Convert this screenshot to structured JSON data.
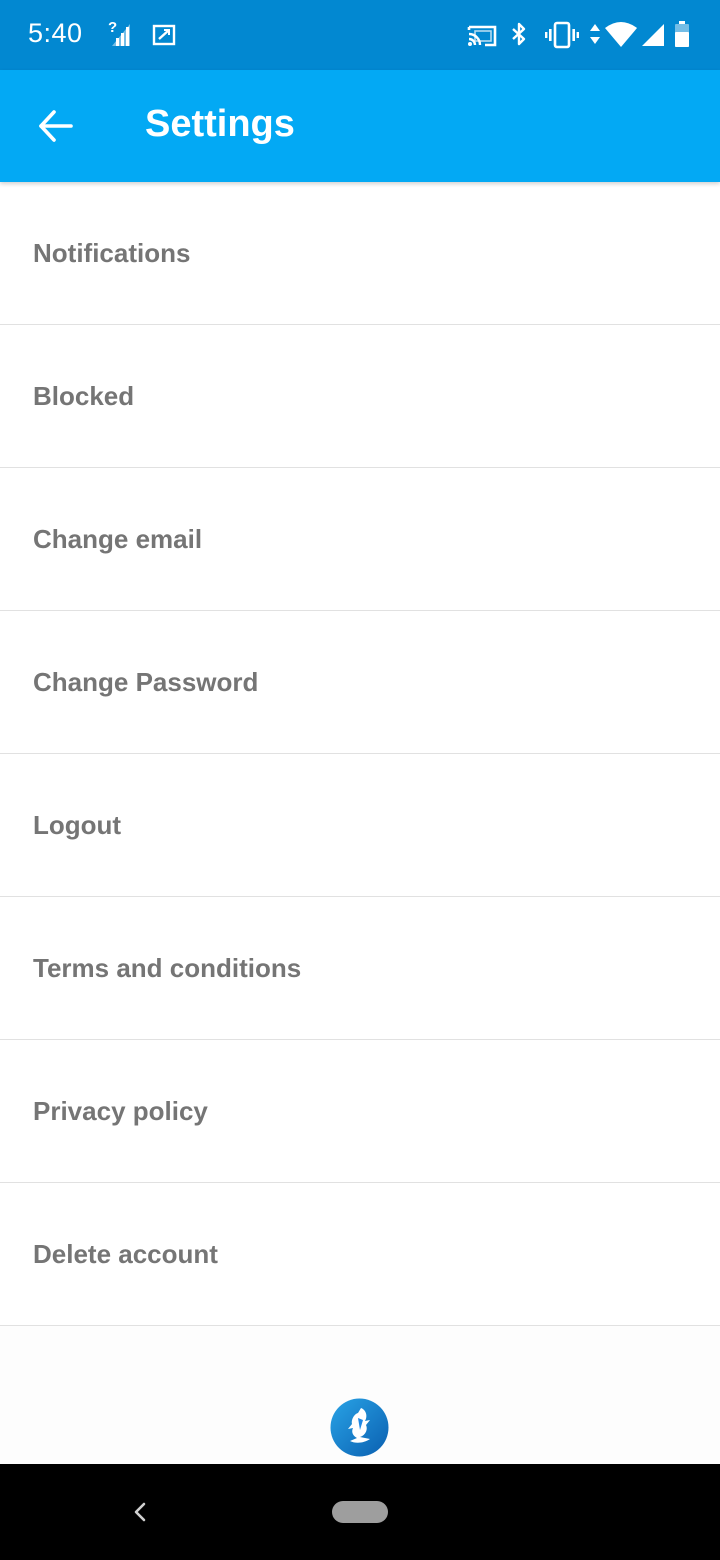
{
  "status_bar": {
    "time": "5:40",
    "icons": [
      "signal-unknown-icon",
      "screenshot-icon",
      "cast-icon",
      "bluetooth-icon",
      "vibrate-icon",
      "data-arrows-icon",
      "wifi-icon",
      "cell-signal-icon",
      "battery-icon"
    ]
  },
  "app_bar": {
    "title": "Settings",
    "back_icon": "arrow-back-icon",
    "color": "#03a9f4"
  },
  "settings": {
    "items": [
      {
        "label": "Notifications"
      },
      {
        "label": "Blocked"
      },
      {
        "label": "Change email"
      },
      {
        "label": "Change Password"
      },
      {
        "label": "Logout"
      },
      {
        "label": "Terms and conditions"
      },
      {
        "label": "Privacy policy"
      },
      {
        "label": "Delete account"
      }
    ]
  },
  "footer": {
    "logo_icon": "app-logo-icon"
  },
  "nav_bar": {
    "back_icon": "nav-back-icon",
    "home_icon": "nav-home-pill-icon"
  },
  "colors": {
    "status_bar": "#0288d1",
    "app_bar": "#03a9f4",
    "item_text": "#757575",
    "divider": "#e1e1e1"
  }
}
